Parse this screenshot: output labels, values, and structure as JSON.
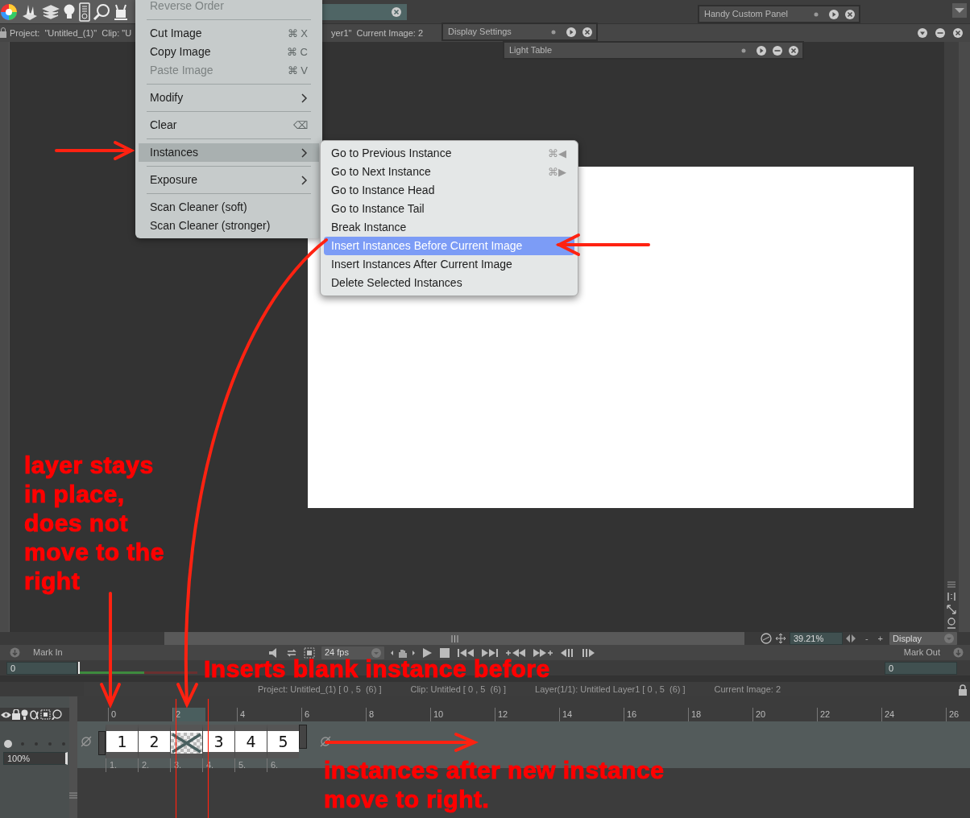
{
  "info_bar": {
    "left_text": "Project:  \"Untitled_(1)\"  Clip: \"U",
    "right_text": "yer1\"  Current Image: 2"
  },
  "panels": [
    {
      "title": "Handy Custom Panel",
      "kind": "top"
    },
    {
      "title": "Display Settings",
      "kind": "display"
    },
    {
      "title": "Light Table",
      "kind": "light"
    }
  ],
  "viewer": {
    "zoom": "39.21%",
    "zoom_out": "-",
    "zoom_in": "+",
    "display_menu": "Display"
  },
  "transport": {
    "mark_in_label": "Mark In",
    "fps": "24 fps",
    "mark_out_label": "Mark Out",
    "mark_in_value": "0",
    "mark_out_value": "0"
  },
  "status_bar": [
    "Project: Untitled_(1) [ 0 , 5  (6) ]",
    "Clip: Untitled [ 0 , 5  (6) ]",
    "Layer(1/1): Untitled Layer1 [ 0 , 5  (6) ]",
    "Current Image: 2"
  ],
  "timeline": {
    "opacity": "100%",
    "ruler": [
      {
        "label": "0",
        "selected": false
      },
      {
        "label": "2",
        "selected": true
      },
      {
        "label": "4",
        "selected": false
      },
      {
        "label": "6",
        "selected": false
      },
      {
        "label": "8",
        "selected": false
      },
      {
        "label": "10",
        "selected": false
      },
      {
        "label": "12",
        "selected": false
      },
      {
        "label": "14",
        "selected": false
      },
      {
        "label": "16",
        "selected": false
      },
      {
        "label": "18",
        "selected": false
      },
      {
        "label": "20",
        "selected": false
      },
      {
        "label": "22",
        "selected": false
      },
      {
        "label": "24",
        "selected": false
      },
      {
        "label": "26",
        "selected": false
      }
    ],
    "cells": [
      {
        "kind": "drawing",
        "label": "1"
      },
      {
        "kind": "drawing",
        "label": "2"
      },
      {
        "kind": "blank"
      },
      {
        "kind": "drawing",
        "label": "3"
      },
      {
        "kind": "drawing",
        "label": "4"
      },
      {
        "kind": "drawing",
        "label": "5"
      }
    ],
    "instance_numbers": [
      "1.",
      "2.",
      "3.",
      "4.",
      "5.",
      "6."
    ]
  },
  "context_menu": {
    "groups": [
      [
        {
          "label": "Reverse Order",
          "disabled": true,
          "selected": false,
          "submenu": false
        }
      ],
      [
        {
          "label": "Cut Image",
          "shortcut": "⌘ X",
          "disabled": false,
          "selected": false,
          "submenu": false
        },
        {
          "label": "Copy Image",
          "shortcut": "⌘ C",
          "disabled": false,
          "selected": false,
          "submenu": false
        },
        {
          "label": "Paste Image",
          "shortcut": "⌘ V",
          "disabled": true,
          "selected": false,
          "submenu": false
        }
      ],
      [
        {
          "label": "Modify",
          "disabled": false,
          "selected": false,
          "submenu": true
        }
      ],
      [
        {
          "label": "Clear",
          "shortcut": "⌫",
          "disabled": false,
          "selected": false,
          "submenu": false
        }
      ],
      [
        {
          "label": "Instances",
          "disabled": false,
          "selected": true,
          "submenu": true
        }
      ],
      [
        {
          "label": "Exposure",
          "disabled": false,
          "selected": false,
          "submenu": true
        }
      ],
      [
        {
          "label": "Scan Cleaner (soft)",
          "disabled": false,
          "selected": false,
          "submenu": false
        },
        {
          "label": "Scan Cleaner (stronger)",
          "disabled": false,
          "selected": false,
          "submenu": false
        }
      ]
    ]
  },
  "submenu": {
    "items": [
      {
        "label": "Go to Previous Instance",
        "shortcut": "⌘◀",
        "selected": false
      },
      {
        "label": "Go to Next Instance",
        "shortcut": "⌘▶",
        "selected": false
      },
      {
        "label": "Go to Instance Head",
        "selected": false
      },
      {
        "label": "Go to Instance Tail",
        "selected": false
      },
      {
        "label": "Break Instance",
        "selected": false
      },
      {
        "label": "Insert Instances Before Current Image",
        "selected": true
      },
      {
        "label": "Insert Instances After Current Image",
        "selected": false
      },
      {
        "label": "Delete Selected Instances",
        "selected": false
      }
    ]
  },
  "annotations": [
    {
      "kind": "layer",
      "text": "layer stays in place, does not move to the right"
    },
    {
      "kind": "inserts",
      "text": "Inserts blank instance before"
    },
    {
      "kind": "after",
      "text": "instances after new instance move to right."
    }
  ]
}
